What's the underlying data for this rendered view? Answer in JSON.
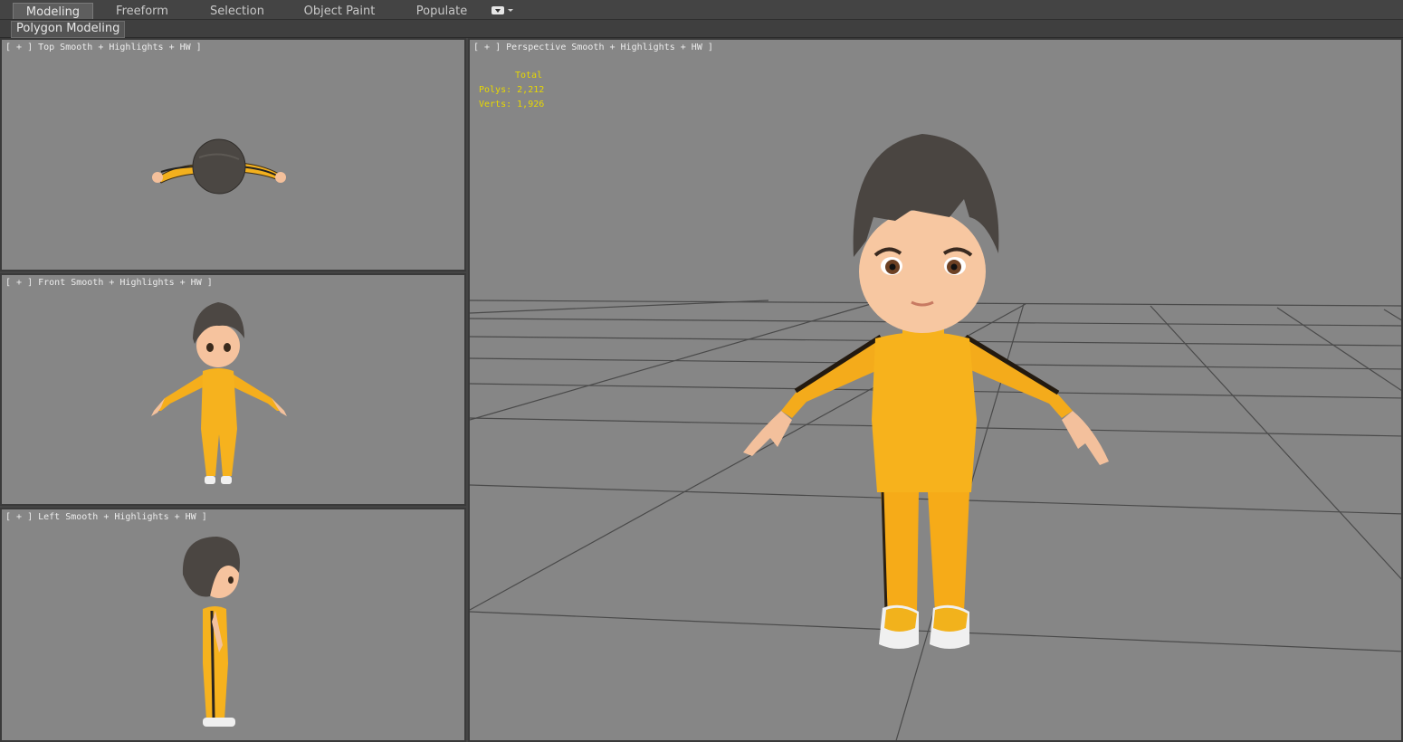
{
  "ribbon": {
    "tabs": [
      "Modeling",
      "Freeform",
      "Selection",
      "Object Paint",
      "Populate"
    ],
    "active_tab": "Modeling",
    "panel_label": "Polygon Modeling"
  },
  "viewports": {
    "top": {
      "plus": "[ + ]",
      "view": "Top",
      "shading": "Smooth + Highlights + HW ]"
    },
    "front": {
      "plus": "[ + ]",
      "view": "Front",
      "shading": "Smooth + Highlights + HW ]"
    },
    "left": {
      "plus": "[ + ]",
      "view": "Left",
      "shading": "Smooth + Highlights + HW ]"
    },
    "perspective": {
      "plus": "[ + ]",
      "view": "Perspective",
      "shading": "Smooth + Highlights + HW ]"
    }
  },
  "stats": {
    "header": "Total",
    "polys_label": "Polys:",
    "polys_value": "2,212",
    "verts_label": "Verts:",
    "verts_value": "1,926"
  },
  "colors": {
    "viewport_bg": "#868686",
    "stats_text": "#e8d800",
    "suit": "#f7b21c",
    "hair": "#4a4541",
    "skin": "#f6c39e"
  }
}
